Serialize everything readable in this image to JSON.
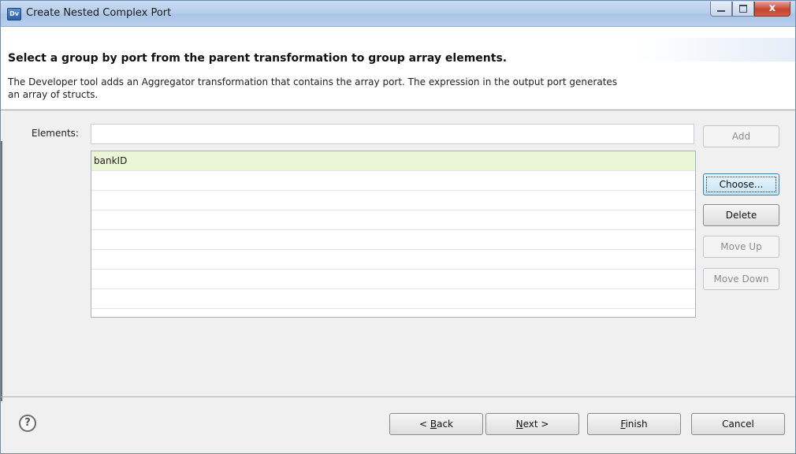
{
  "window": {
    "app_icon_text": "Dv",
    "title": "Create Nested Complex Port",
    "close_glyph": "x"
  },
  "header": {
    "title": "Select a group by port from the parent transformation to group array elements.",
    "description": "The Developer tool adds an Aggregator transformation that contains the array port. The expression in the output port generates an array of structs."
  },
  "elements": {
    "label": "Elements:",
    "input_value": "",
    "list": [
      "bankID",
      "",
      "",
      "",
      "",
      "",
      "",
      ""
    ]
  },
  "side_buttons": {
    "add": "Add",
    "choose": "Choose...",
    "delete": "Delete",
    "move_up": "Move Up",
    "move_down": "Move Down"
  },
  "footer": {
    "help_glyph": "?",
    "back_prefix": "< ",
    "back_mnemonic": "B",
    "back_rest": "ack",
    "next_mnemonic": "N",
    "next_rest": "ext >",
    "finish_mnemonic": "F",
    "finish_rest": "inish",
    "cancel": "Cancel"
  },
  "colors": {
    "selected_row": "#ebf6d6",
    "focus_border": "#3c7fb1",
    "title_bar": "#b7cfeb"
  }
}
